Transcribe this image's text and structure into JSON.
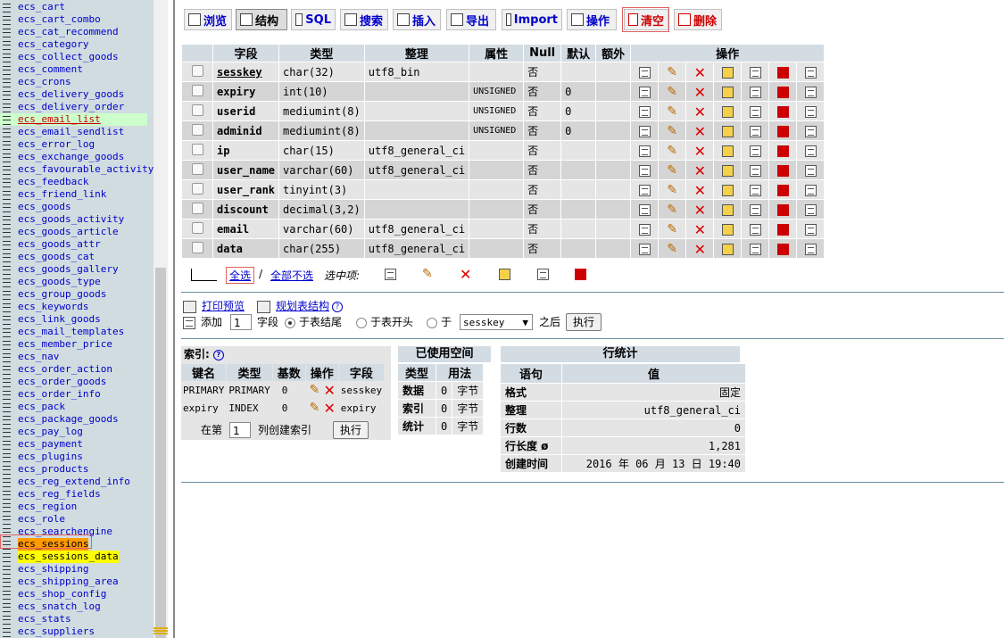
{
  "sidebar": {
    "tables": [
      "ecs_cart",
      "ecs_cart_combo",
      "ecs_cat_recommend",
      "ecs_category",
      "ecs_collect_goods",
      "ecs_comment",
      "ecs_crons",
      "ecs_delivery_goods",
      "ecs_delivery_order",
      "ecs_email_list",
      "ecs_email_sendlist",
      "ecs_error_log",
      "ecs_exchange_goods",
      "ecs_favourable_activity",
      "ecs_feedback",
      "ecs_friend_link",
      "ecs_goods",
      "ecs_goods_activity",
      "ecs_goods_article",
      "ecs_goods_attr",
      "ecs_goods_cat",
      "ecs_goods_gallery",
      "ecs_goods_type",
      "ecs_group_goods",
      "ecs_keywords",
      "ecs_link_goods",
      "ecs_mail_templates",
      "ecs_member_price",
      "ecs_nav",
      "ecs_order_action",
      "ecs_order_goods",
      "ecs_order_info",
      "ecs_pack",
      "ecs_package_goods",
      "ecs_pay_log",
      "ecs_payment",
      "ecs_plugins",
      "ecs_products",
      "ecs_reg_extend_info",
      "ecs_reg_fields",
      "ecs_region",
      "ecs_role",
      "ecs_searchengine",
      "ecs_sessions",
      "ecs_sessions_data",
      "ecs_shipping",
      "ecs_shipping_area",
      "ecs_shop_config",
      "ecs_snatch_log",
      "ecs_stats",
      "ecs_suppliers"
    ]
  },
  "tabs": [
    "浏览",
    "结构",
    "SQL",
    "搜索",
    "插入",
    "导出",
    "Import",
    "操作",
    "清空",
    "删除"
  ],
  "fields": {
    "headers": [
      "字段",
      "类型",
      "整理",
      "属性",
      "Null",
      "默认",
      "额外",
      "操作"
    ],
    "rows": [
      [
        "sesskey",
        "char(32)",
        "utf8_bin",
        "",
        "否",
        ""
      ],
      [
        "expiry",
        "int(10)",
        "",
        "UNSIGNED",
        "否",
        "0"
      ],
      [
        "userid",
        "mediumint(8)",
        "",
        "UNSIGNED",
        "否",
        "0"
      ],
      [
        "adminid",
        "mediumint(8)",
        "",
        "UNSIGNED",
        "否",
        "0"
      ],
      [
        "ip",
        "char(15)",
        "utf8_general_ci",
        "",
        "否",
        ""
      ],
      [
        "user_name",
        "varchar(60)",
        "utf8_general_ci",
        "",
        "否",
        ""
      ],
      [
        "user_rank",
        "tinyint(3)",
        "",
        "",
        "否",
        ""
      ],
      [
        "discount",
        "decimal(3,2)",
        "",
        "",
        "否",
        ""
      ],
      [
        "email",
        "varchar(60)",
        "utf8_general_ci",
        "",
        "否",
        ""
      ],
      [
        "data",
        "char(255)",
        "utf8_general_ci",
        "",
        "否",
        ""
      ]
    ]
  },
  "selection": {
    "check_all": "全选",
    "sep": "/",
    "uncheck_all": "全部不选",
    "with_selected": "选中项:"
  },
  "links": {
    "print": "打印预览",
    "plan": "规划表结构",
    "help": "?"
  },
  "add_field": {
    "add": "添加",
    "count": "1",
    "unit": "字段",
    "end": "于表结尾",
    "start": "于表开头",
    "after_label": "于",
    "after_field": "sesskey",
    "after": "之后",
    "go": "执行"
  },
  "indexes": {
    "title": "索引:",
    "help": "?",
    "headers": [
      "键名",
      "类型",
      "基数",
      "操作",
      "字段"
    ],
    "rows": [
      [
        "PRIMARY",
        "PRIMARY",
        "0",
        "sesskey"
      ],
      [
        "expiry",
        "INDEX",
        "0",
        "expiry"
      ]
    ],
    "create_pre": "在第",
    "create_count": "1",
    "create_post": "列创建索引",
    "go": "执行"
  },
  "space": {
    "title": "已使用空间",
    "headers": [
      "类型",
      "用法"
    ],
    "rows": [
      [
        "数据",
        "0",
        "字节"
      ],
      [
        "索引",
        "0",
        "字节"
      ],
      [
        "统计",
        "0",
        "字节"
      ]
    ]
  },
  "rowstats": {
    "title": "行统计",
    "headers": [
      "语句",
      "值"
    ],
    "rows": [
      [
        "格式",
        "固定"
      ],
      [
        "整理",
        "utf8_general_ci"
      ],
      [
        "行数",
        "0"
      ],
      [
        "行长度 ø",
        "1,281"
      ],
      [
        "创建时间",
        "2016 年 06 月 13 日 19:40"
      ]
    ]
  }
}
